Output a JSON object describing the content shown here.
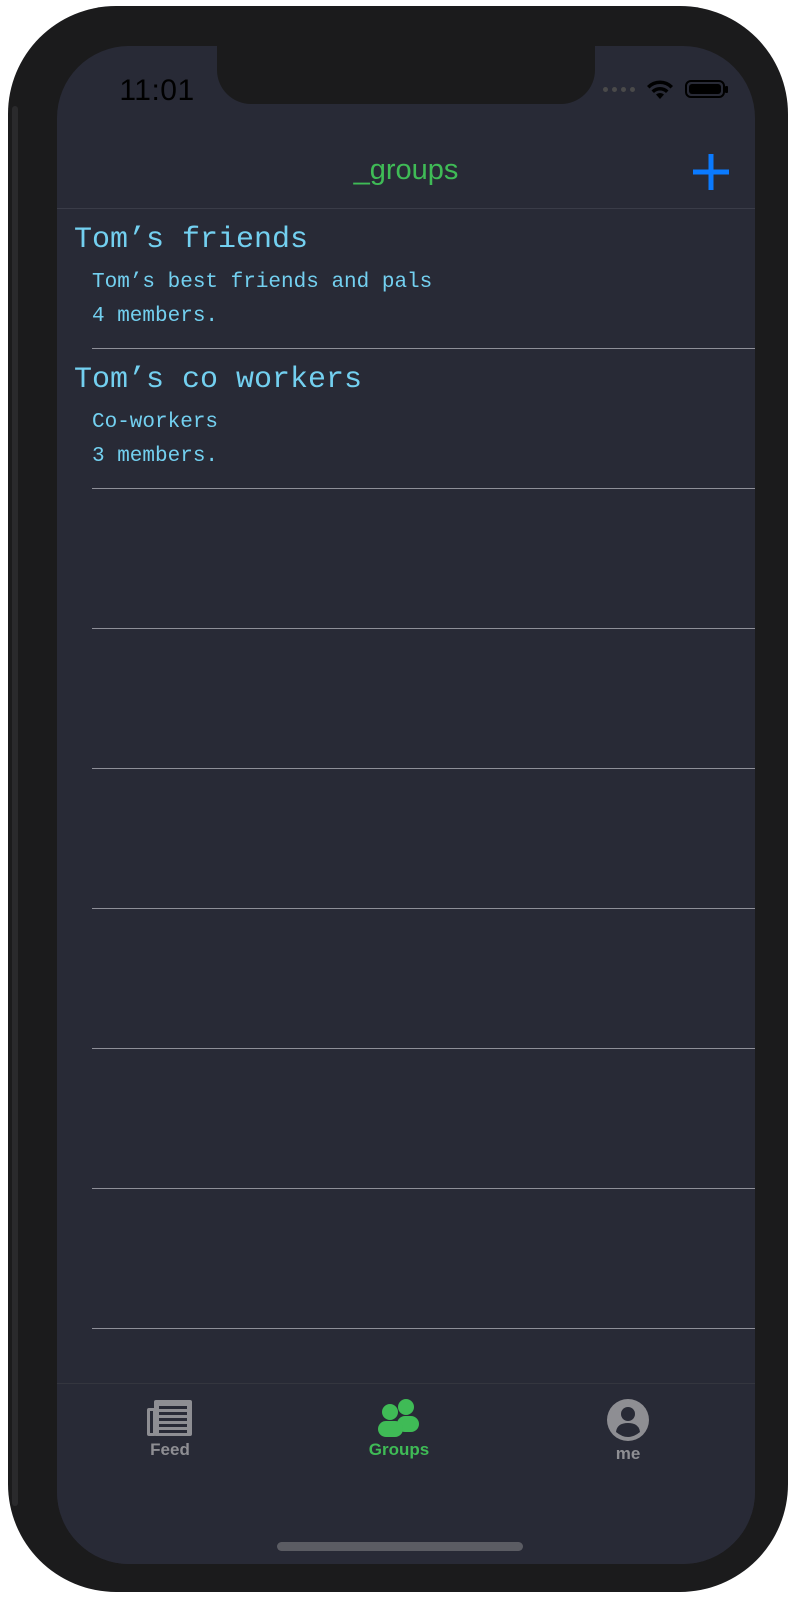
{
  "status_bar": {
    "time": "11:01"
  },
  "nav": {
    "title": "_groups",
    "add_icon": "plus-icon",
    "title_color": "#3fbb56",
    "accent_color": "#0a7aff"
  },
  "groups": [
    {
      "name": "Tom’s friends",
      "description": "Tom’s best friends and pals",
      "members": "4 members."
    },
    {
      "name": "Tom’s co workers",
      "description": "Co-workers",
      "members": "3 members."
    }
  ],
  "tabs": [
    {
      "label": "Feed",
      "icon": "newspaper-icon",
      "selected": false
    },
    {
      "label": "Groups",
      "icon": "groups-icon",
      "selected": true
    },
    {
      "label": "me",
      "icon": "user-circle-icon",
      "selected": false
    }
  ],
  "colors": {
    "background": "#282a36",
    "text": "#73d0f0",
    "tab_active": "#3fbb56",
    "tab_inactive": "#8e8e93"
  }
}
